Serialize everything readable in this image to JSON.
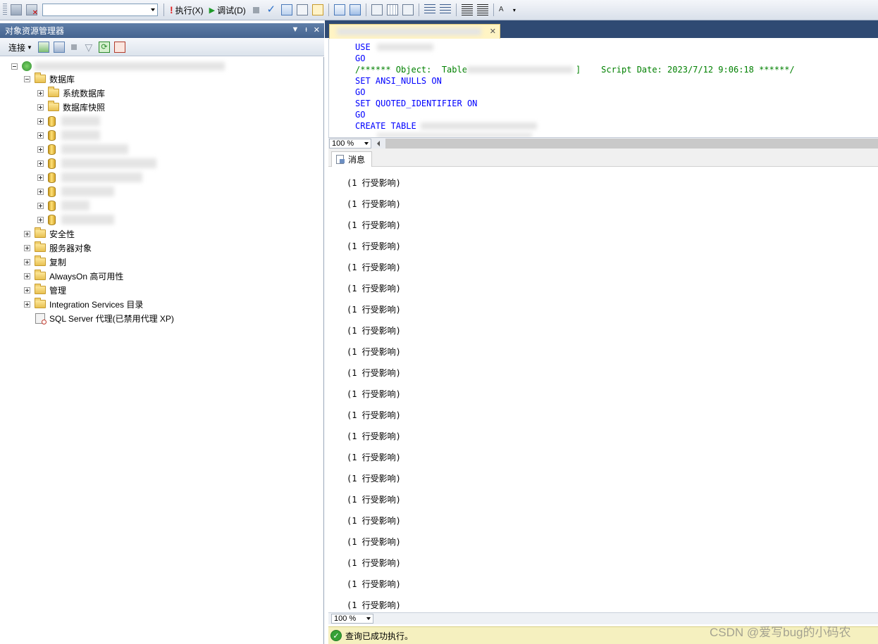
{
  "toolbar": {
    "execute_label": "执行(X)",
    "debug_label": "调试(D)"
  },
  "object_explorer": {
    "title": "对象资源管理器",
    "connect_label": "连接",
    "nodes": [
      {
        "label": "数据库"
      },
      {
        "label": "系统数据库"
      },
      {
        "label": "数据库快照"
      },
      {
        "label": "安全性"
      },
      {
        "label": "服务器对象"
      },
      {
        "label": "复制"
      },
      {
        "label": "AlwaysOn 高可用性"
      },
      {
        "label": "管理"
      },
      {
        "label": "Integration Services 目录"
      },
      {
        "label": "SQL Server 代理(已禁用代理 XP)"
      }
    ]
  },
  "editor": {
    "lines": [
      {
        "kw": "USE",
        "rest": ""
      },
      {
        "kw": "GO",
        "rest": ""
      },
      {
        "comment1": "/****** Object:  Table ",
        "comment2": "]    Script Date: 2023/7/12 9:06:18 ******/"
      },
      {
        "kw": "SET ANSI_NULLS ON"
      },
      {
        "kw": "GO"
      },
      {
        "kw": "SET QUOTED_IDENTIFIER ON"
      },
      {
        "kw": "GO"
      },
      {
        "kw": "CREATE TABLE"
      }
    ]
  },
  "results": {
    "tab_label": "消息",
    "messages": [
      "(1 行受影响)",
      "(1 行受影响)",
      "(1 行受影响)",
      "(1 行受影响)",
      "(1 行受影响)",
      "(1 行受影响)",
      "(1 行受影响)",
      "(1 行受影响)",
      "(1 行受影响)",
      "(1 行受影响)",
      "(1 行受影响)",
      "(1 行受影响)",
      "(1 行受影响)",
      "(1 行受影响)",
      "(1 行受影响)",
      "(1 行受影响)",
      "(1 行受影响)",
      "(1 行受影响)",
      "(1 行受影响)",
      "(1 行受影响)",
      "(1 行受影响)",
      "(1 行受影响)"
    ]
  },
  "zoom": {
    "editor": "100 %",
    "results": "100 %"
  },
  "status": {
    "text": "查询已成功执行。"
  },
  "watermark": "CSDN @爱写bug的小码农",
  "colors": {
    "keyword": "#0000ff",
    "comment": "#008000",
    "status_bg": "#f5f0bf"
  }
}
